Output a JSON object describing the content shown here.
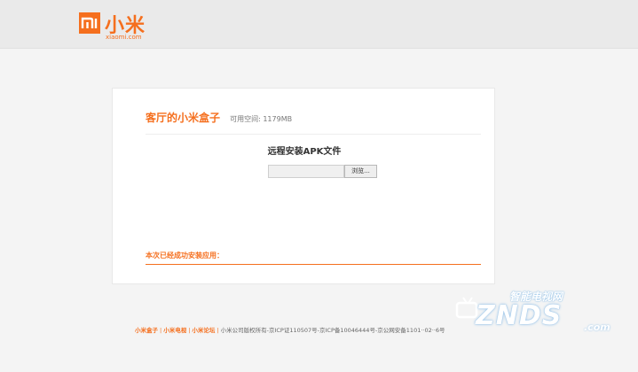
{
  "header": {
    "logo_text_cn": "小米",
    "logo_url": "xiaomi.com"
  },
  "panel": {
    "title": "客厅的小米盒子",
    "space_label": "可用空间: 1179MB",
    "section_title": "远程安装APK文件",
    "file_input_value": "",
    "browse_label": "浏览...",
    "installed_label": "本次已经成功安装应用："
  },
  "footer": {
    "link1": "小米盒子",
    "link2": "小米电视",
    "link3": "小米论坛",
    "separator": "|",
    "copyright": "小米公司版权所有-京ICP证110507号-京ICP备10046444号-京公网安备1101··02··6号"
  },
  "watermark": {
    "cn": "智能电视网",
    "main": "ZNDS",
    "suffix": ".com"
  },
  "colors": {
    "accent": "#f56f1e",
    "background": "#f4f4f4"
  }
}
